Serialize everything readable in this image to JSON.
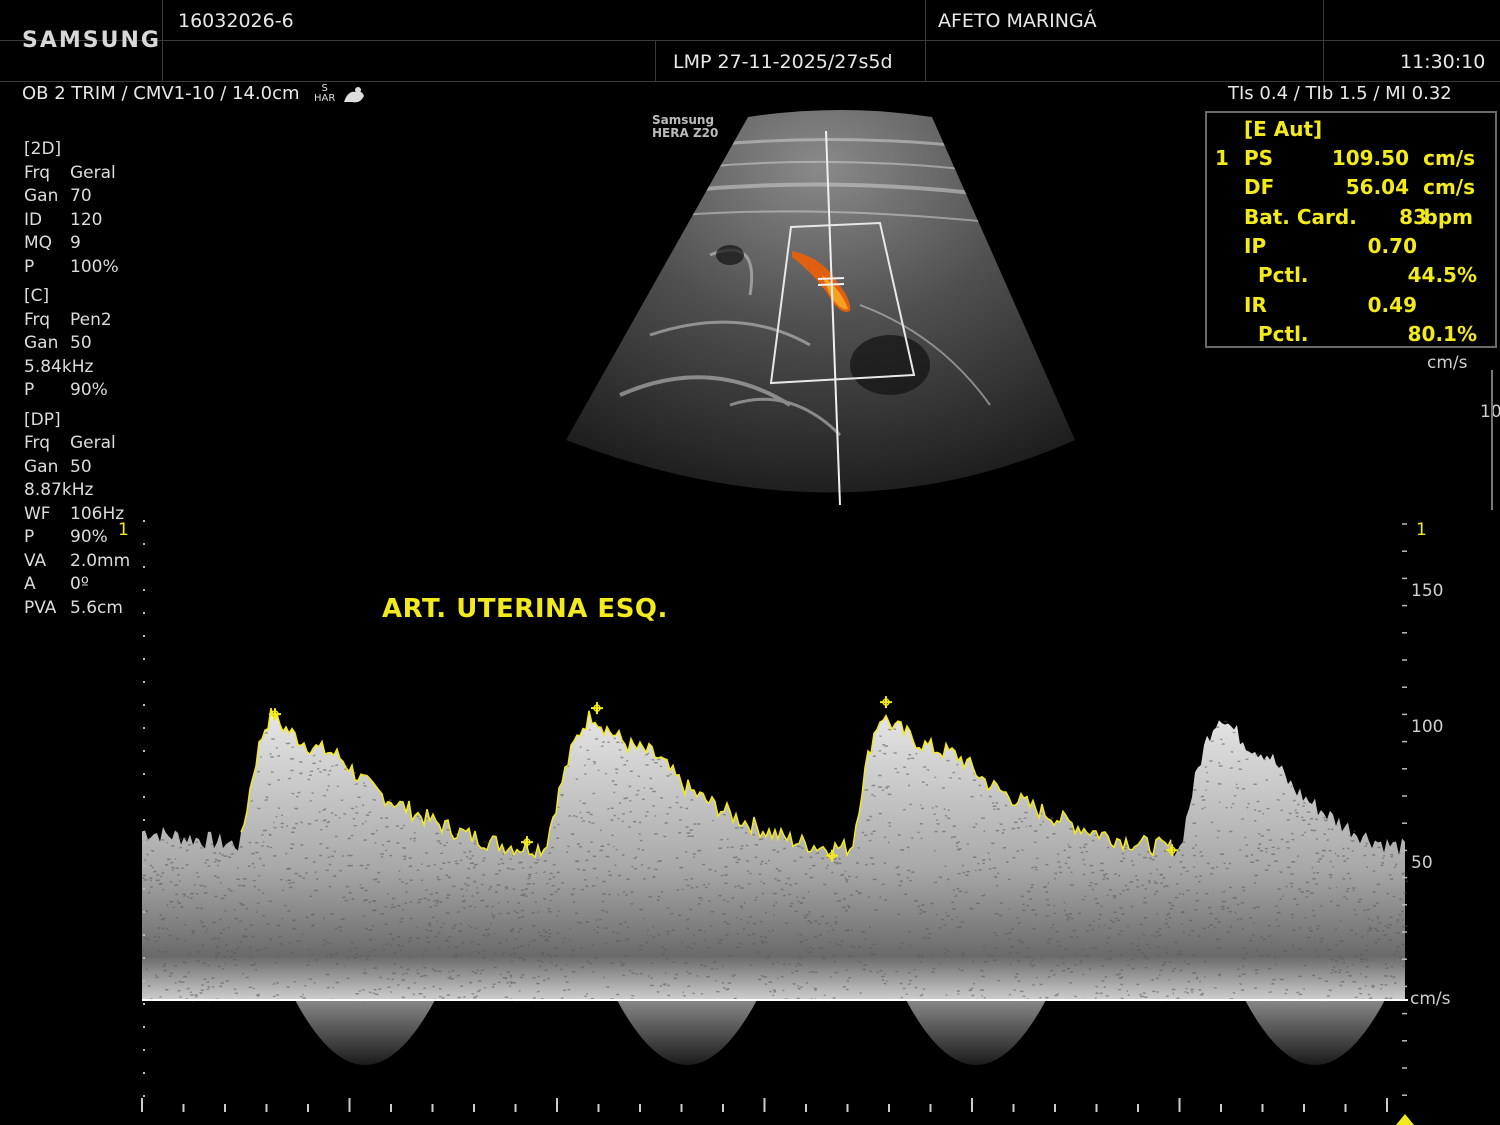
{
  "header": {
    "brand": "SAMSUNG",
    "patient_id": "16032026-6",
    "institution": "AFETO MARINGÁ",
    "lmp": "LMP 27-11-2025/27s5d",
    "time": "11:30:10"
  },
  "status_line": {
    "preset": "OB 2 TRIM / CMV1-10 / 14.0cm",
    "har_top": "S",
    "har_bottom": "HAR",
    "thermal": "TIs  0.4 / TIb  1.5 / MI  0.32"
  },
  "probe_label": {
    "line1": "Samsung",
    "line2": "HERA Z20"
  },
  "params": [
    {
      "k": "[2D]",
      "v": ""
    },
    {
      "k": "Frq",
      "v": "Geral"
    },
    {
      "k": "Gan",
      "v": "70"
    },
    {
      "k": "ID",
      "v": "120"
    },
    {
      "k": "MQ",
      "v": "9"
    },
    {
      "k": "P",
      "v": "100%"
    },
    {
      "k": "[C]",
      "v": ""
    },
    {
      "k": "Frq",
      "v": "Pen2"
    },
    {
      "k": "Gan",
      "v": "50"
    },
    {
      "k": "5.84kHz",
      "v": ""
    },
    {
      "k": "P",
      "v": "90%"
    },
    {
      "k": "[DP]",
      "v": ""
    },
    {
      "k": "Frq",
      "v": "Geral"
    },
    {
      "k": "Gan",
      "v": "50"
    },
    {
      "k": "8.87kHz",
      "v": ""
    },
    {
      "k": "WF",
      "v": "106Hz"
    },
    {
      "k": "P",
      "v": "90%"
    },
    {
      "k": "VA",
      "v": "2.0mm"
    },
    {
      "k": "A",
      "v": "0º"
    },
    {
      "k": "PVA",
      "v": "5.6cm"
    }
  ],
  "measurements": {
    "mode": "[E Aut]",
    "index": "1",
    "rows": [
      {
        "label": "PS",
        "value": "109.50",
        "unit": "cm/s"
      },
      {
        "label": "DF",
        "value": "56.04",
        "unit": "cm/s"
      },
      {
        "label": "Bat. Card.",
        "value": "83",
        "unit": "bpm"
      },
      {
        "label": "IP",
        "value": "0.70",
        "unit": ""
      },
      {
        "label": "Pctl.",
        "value": "44.5%",
        "unit": ""
      },
      {
        "label": "IR",
        "value": "0.49",
        "unit": ""
      },
      {
        "label": "Pctl.",
        "value": "80.1%",
        "unit": ""
      }
    ]
  },
  "color_scale": {
    "unit": "cm/s",
    "partial": "10"
  },
  "doppler": {
    "title": "ART. UTERINA ESQ.",
    "cursor_marker": "1",
    "scale_unit": "cm/s",
    "scale_ticks": [
      150,
      100,
      50
    ],
    "peak_velocity": 109.5,
    "end_diastolic_velocity": 56.04,
    "colors": {
      "trace": "#f2ea1a",
      "baseline": "#ffffff",
      "text": "#f2ea1a"
    }
  }
}
